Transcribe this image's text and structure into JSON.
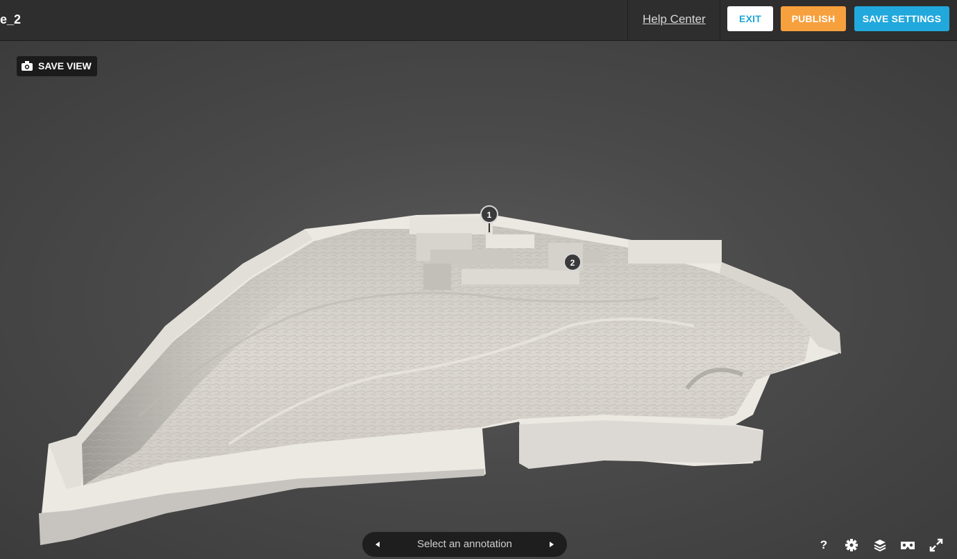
{
  "header": {
    "title": "e_2",
    "help_link": "Help Center",
    "exit_label": "EXIT",
    "publish_label": "PUBLISH",
    "save_settings_label": "SAVE SETTINGS"
  },
  "viewer": {
    "save_view_label": "SAVE VIEW",
    "annotation_markers": [
      "1",
      "2"
    ],
    "annotation_nav": {
      "placeholder": "Select an annotation"
    }
  },
  "toolbar": {
    "help_label": "?",
    "icons": [
      "help-icon",
      "settings-gear-icon",
      "layers-icon",
      "vr-headset-icon",
      "fullscreen-icon"
    ]
  },
  "colors": {
    "exit_text": "#1fa6d8",
    "publish": "#f7a03e",
    "save_settings": "#21a8dc",
    "topbar": "#2e2e2e"
  }
}
